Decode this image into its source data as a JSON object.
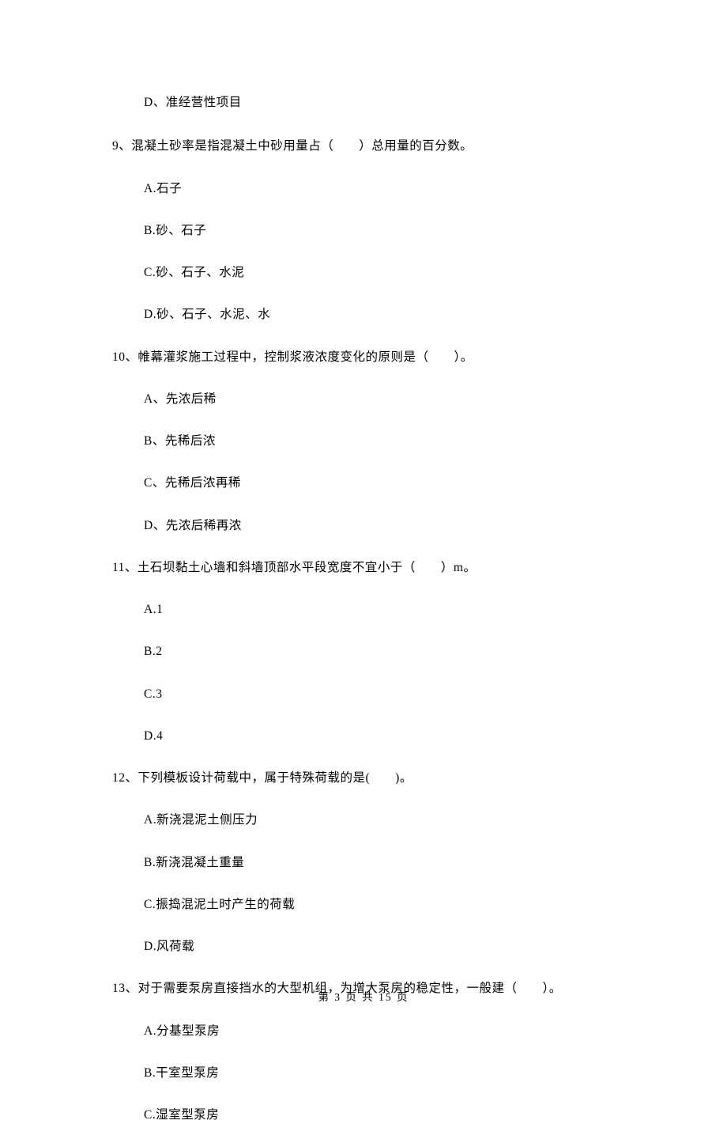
{
  "preOption": "D、准经营性项目",
  "questions": [
    {
      "text": "9、混凝土砂率是指混凝土中砂用量占（　　）总用量的百分数。",
      "options": [
        "A.石子",
        "B.砂、石子",
        "C.砂、石子、水泥",
        "D.砂、石子、水泥、水"
      ]
    },
    {
      "text": "10、帷幕灌浆施工过程中，控制浆液浓度变化的原则是（　　）。",
      "options": [
        "A、先浓后稀",
        "B、先稀后浓",
        "C、先稀后浓再稀",
        "D、先浓后稀再浓"
      ]
    },
    {
      "text": "11、土石坝黏土心墙和斜墙顶部水平段宽度不宜小于（　　）m。",
      "options": [
        "A.1",
        "B.2",
        "C.3",
        "D.4"
      ]
    },
    {
      "text": "12、下列模板设计荷载中，属于特殊荷载的是(　　)。",
      "options": [
        "A.新浇混泥土侧压力",
        "B.新浇混凝土重量",
        "C.振捣混泥土时产生的荷载",
        "D.风荷载"
      ]
    },
    {
      "text": "13、对于需要泵房直接挡水的大型机组，为增大泵房的稳定性，一般建（　　）。",
      "options": [
        "A.分基型泵房",
        "B.干室型泵房",
        "C.湿室型泵房"
      ]
    }
  ],
  "footer": "第 3 页 共 15 页"
}
